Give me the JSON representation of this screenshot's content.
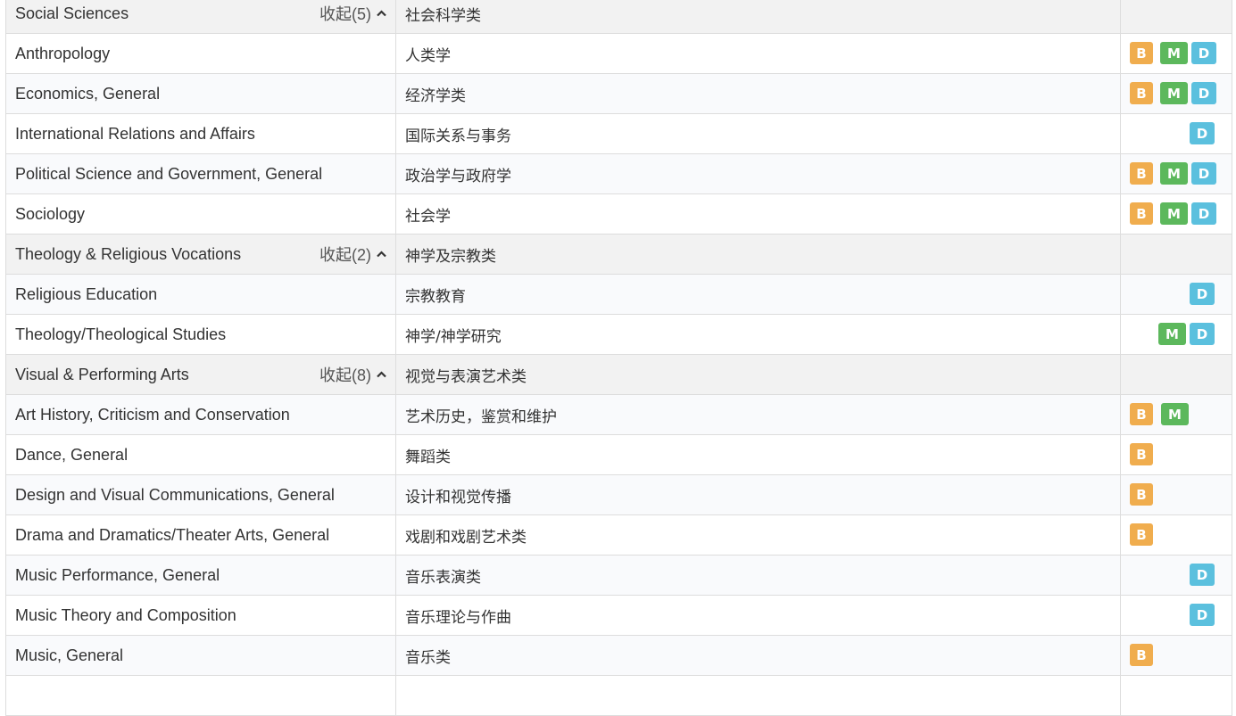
{
  "badge_colors": {
    "B": "#f0ad4e",
    "M": "#5cb85c",
    "D": "#5bc0de"
  },
  "icons": {
    "collapse": "chevron-up-icon"
  },
  "rows": [
    {
      "type": "category",
      "en": "Social Sciences",
      "zh": "社会科学类",
      "toggle": "收起(5)"
    },
    {
      "type": "major",
      "en": "Anthropology",
      "zh": "人类学",
      "degrees": [
        "B",
        "M",
        "D"
      ]
    },
    {
      "type": "major",
      "en": "Economics, General",
      "zh": "经济学类",
      "degrees": [
        "B",
        "M",
        "D"
      ]
    },
    {
      "type": "major",
      "en": "International Relations and Affairs",
      "zh": "国际关系与事务",
      "degrees": [
        "D"
      ]
    },
    {
      "type": "major",
      "en": "Political Science and Government, General",
      "zh": "政治学与政府学",
      "degrees": [
        "B",
        "M",
        "D"
      ]
    },
    {
      "type": "major",
      "en": "Sociology",
      "zh": "社会学",
      "degrees": [
        "B",
        "M",
        "D"
      ]
    },
    {
      "type": "category",
      "en": "Theology & Religious Vocations",
      "zh": "神学及宗教类",
      "toggle": "收起(2)"
    },
    {
      "type": "major",
      "en": "Religious Education",
      "zh": "宗教教育",
      "degrees": [
        "D"
      ]
    },
    {
      "type": "major",
      "en": "Theology/Theological Studies",
      "zh": "神学/神学研究",
      "degrees": [
        "M",
        "D"
      ]
    },
    {
      "type": "category",
      "en": "Visual & Performing Arts",
      "zh": "视觉与表演艺术类",
      "toggle": "收起(8)"
    },
    {
      "type": "major",
      "en": "Art History, Criticism and Conservation",
      "zh": "艺术历史，鉴赏和维护",
      "degrees": [
        "B",
        "M"
      ]
    },
    {
      "type": "major",
      "en": "Dance, General",
      "zh": "舞蹈类",
      "degrees": [
        "B"
      ]
    },
    {
      "type": "major",
      "en": "Design and Visual Communications, General",
      "zh": "设计和视觉传播",
      "degrees": [
        "B"
      ]
    },
    {
      "type": "major",
      "en": "Drama and Dramatics/Theater Arts, General",
      "zh": "戏剧和戏剧艺术类",
      "degrees": [
        "B"
      ]
    },
    {
      "type": "major",
      "en": "Music Performance, General",
      "zh": "音乐表演类",
      "degrees": [
        "D"
      ]
    },
    {
      "type": "major",
      "en": "Music Theory and Composition",
      "zh": "音乐理论与作曲",
      "degrees": [
        "D"
      ]
    },
    {
      "type": "major",
      "en": "Music, General",
      "zh": "音乐类",
      "degrees": [
        "B"
      ]
    },
    {
      "type": "major",
      "en": "",
      "zh": "",
      "degrees": []
    }
  ]
}
